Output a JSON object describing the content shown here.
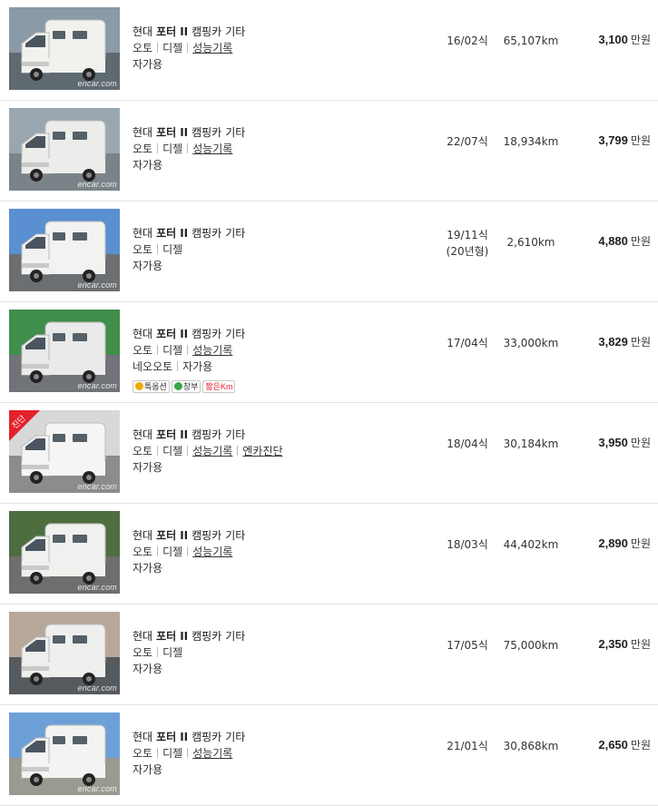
{
  "listings": [
    {
      "maker": "현대",
      "model": "포터",
      "gen": "II",
      "body": "캠핑카",
      "trim": "기타",
      "trans": "오토",
      "fuel": "디젤",
      "links": [
        "성능기록"
      ],
      "use": "자가용",
      "dealer": "",
      "tags": [],
      "year": "16/02식",
      "year_sub": "",
      "km": "65,107km",
      "price": "3,100",
      "unit": "만원",
      "watermark": "encar.com",
      "badge": ""
    },
    {
      "maker": "현대",
      "model": "포터",
      "gen": "II",
      "body": "캠핑카",
      "trim": "기타",
      "trans": "오토",
      "fuel": "디젤",
      "links": [
        "성능기록"
      ],
      "use": "자가용",
      "dealer": "",
      "tags": [],
      "year": "22/07식",
      "year_sub": "",
      "km": "18,934km",
      "price": "3,799",
      "unit": "만원",
      "watermark": "encar.com",
      "badge": ""
    },
    {
      "maker": "현대",
      "model": "포터",
      "gen": "II",
      "body": "캠핑카",
      "trim": "기타",
      "trans": "오토",
      "fuel": "디젤",
      "links": [],
      "use": "자가용",
      "dealer": "",
      "tags": [],
      "year": "19/11식",
      "year_sub": "(20년형)",
      "km": "2,610km",
      "price": "4,880",
      "unit": "만원",
      "watermark": "encar.com",
      "badge": ""
    },
    {
      "maker": "현대",
      "model": "포터",
      "gen": "II",
      "body": "캠핑카",
      "trim": "기타",
      "trans": "오토",
      "fuel": "디젤",
      "links": [
        "성능기록"
      ],
      "use": "자가용",
      "dealer": "네오오토",
      "tags": [
        "특옵션",
        "창부",
        "짧은Km"
      ],
      "year": "17/04식",
      "year_sub": "",
      "km": "33,000km",
      "price": "3,829",
      "unit": "만원",
      "watermark": "encar.com",
      "badge": ""
    },
    {
      "maker": "현대",
      "model": "포터",
      "gen": "II",
      "body": "캠핑카",
      "trim": "기타",
      "trans": "오토",
      "fuel": "디젤",
      "links": [
        "성능기록",
        "엔카진단"
      ],
      "use": "자가용",
      "dealer": "",
      "tags": [],
      "year": "18/04식",
      "year_sub": "",
      "km": "30,184km",
      "price": "3,950",
      "unit": "만원",
      "watermark": "encar.com",
      "badge": "진단"
    },
    {
      "maker": "현대",
      "model": "포터",
      "gen": "II",
      "body": "캠핑카",
      "trim": "기타",
      "trans": "오토",
      "fuel": "디젤",
      "links": [
        "성능기록"
      ],
      "use": "자가용",
      "dealer": "",
      "tags": [],
      "year": "18/03식",
      "year_sub": "",
      "km": "44,402km",
      "price": "2,890",
      "unit": "만원",
      "watermark": "encar.com",
      "badge": ""
    },
    {
      "maker": "현대",
      "model": "포터",
      "gen": "II",
      "body": "캠핑카",
      "trim": "기타",
      "trans": "오토",
      "fuel": "디젤",
      "links": [],
      "use": "자가용",
      "dealer": "",
      "tags": [],
      "year": "17/05식",
      "year_sub": "",
      "km": "75,000km",
      "price": "2,350",
      "unit": "만원",
      "watermark": "encar.com",
      "badge": ""
    },
    {
      "maker": "현대",
      "model": "포터",
      "gen": "II",
      "body": "캠핑카",
      "trim": "기타",
      "trans": "오토",
      "fuel": "디젤",
      "links": [
        "성능기록"
      ],
      "use": "자가용",
      "dealer": "",
      "tags": [],
      "year": "21/01식",
      "year_sub": "",
      "km": "30,868km",
      "price": "2,650",
      "unit": "만원",
      "watermark": "encar.com",
      "badge": ""
    }
  ],
  "colors": {
    "accent_red": "#e4212a",
    "divider": "#e3e3e3"
  }
}
